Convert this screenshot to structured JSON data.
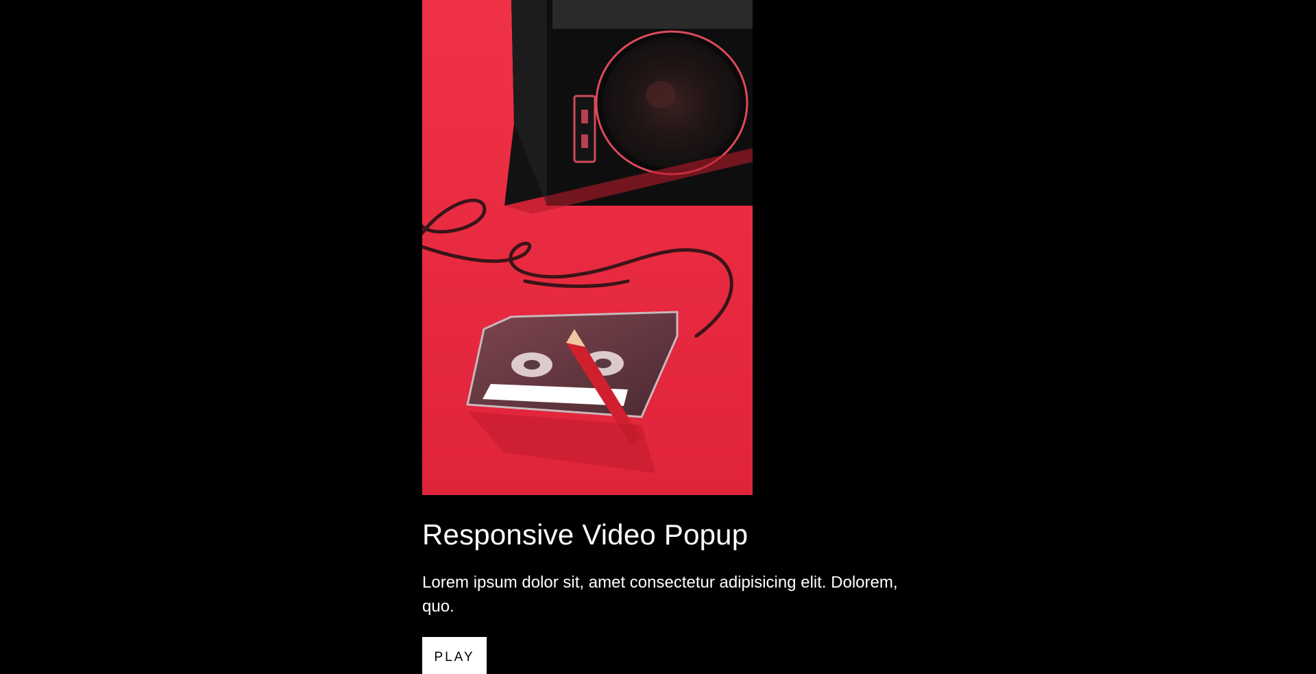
{
  "hero": {
    "image_subject": "cassette-tape-and-boombox-photo"
  },
  "card": {
    "title": "Responsive Video Popup",
    "description": "Lorem ipsum dolor sit, amet consectetur adipisicing elit. Dolorem, quo.",
    "play_label": "PLAY"
  },
  "colors": {
    "background": "#000000",
    "photo_red": "#e8283c",
    "text": "#ffffff",
    "button_bg": "#ffffff",
    "button_text": "#000000"
  }
}
